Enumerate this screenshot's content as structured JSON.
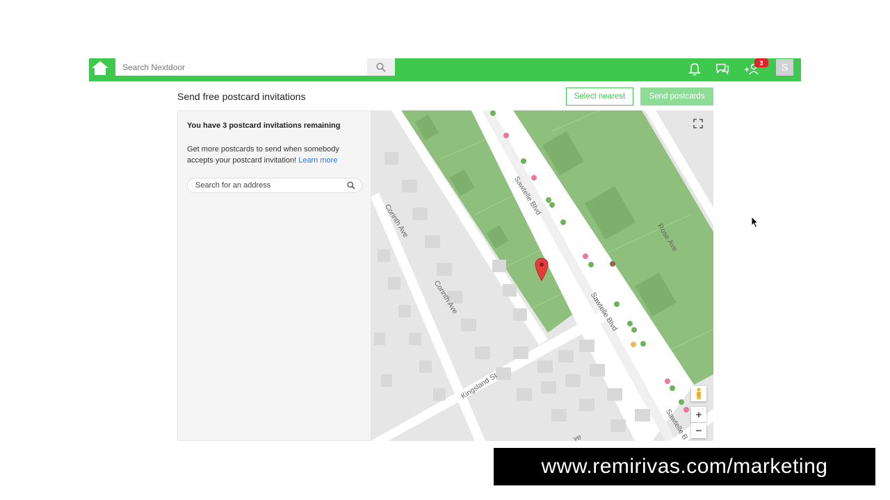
{
  "topbar": {
    "search_placeholder": "Search Nextdoor",
    "notification_badge": "3",
    "avatar_initial": "S",
    "color": "#3ec94e"
  },
  "header": {
    "title": "Send free postcard invitations",
    "select_nearest_label": "Select nearest",
    "send_postcards_label": "Send postcards"
  },
  "panel": {
    "heading": "You have 3 postcard invitations remaining",
    "description": "Get more postcards to send when somebody accepts your postcard invitation!",
    "learn_more": "Learn more",
    "address_placeholder": "Search for an address"
  },
  "map": {
    "streets": [
      "Sawtelle Blvd",
      "Sawtelle Blvd",
      "Corinth Ave",
      "Corinth Ave",
      "Rose Ave",
      "Kingsland St",
      "Sawtelle B",
      "ve"
    ],
    "controls": {
      "zoom_in": "+",
      "zoom_out": "−"
    },
    "icons": [
      "fullscreen-icon",
      "pegman-icon",
      "map-pin-icon"
    ]
  },
  "watermark": "www.remirivas.com/marketing"
}
